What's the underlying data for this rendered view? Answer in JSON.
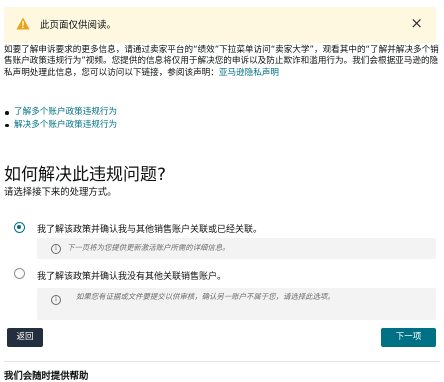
{
  "alert": {
    "message": "此页面仅供阅读。",
    "close_glyph": "×",
    "icon": "warning-triangle-icon",
    "color": "#fff8e1"
  },
  "intro": {
    "text_part1": "如要了解申诉要求的更多信息，请通过卖家平台的“绩效”下拉菜单访问“卖家大学”，观看其中的“了解并解决多个销售账户政策违规行为”视频。您提供的信息将仅用于解决您的申诉以及防止欺诈和滥用行为。我们会根据亚马逊的隐私声明处理此信息，您可以访问以下链接，参阅该声明：",
    "privacy_link": "亚马逊隐私声明"
  },
  "links": [
    {
      "label": "了解多个账户政策违规行为"
    },
    {
      "label": "解决多个账户政策违规行为"
    }
  ],
  "question": {
    "title": "如何解决此违规问题?",
    "subtitle": "请选择接下来的处理方式。"
  },
  "options": [
    {
      "label": "我了解该政策并确认我与其他销售账户关联或已经关联。",
      "selected": true,
      "info": "下一页将为您提供更新激活账户所需的详细信息。"
    },
    {
      "label": "我了解该政策并确认我没有其他关联销售账户。",
      "selected": false,
      "info": "如果您有证据或文件要提交以供审核，确认另一账户不属于您，请选择此选项。"
    }
  ],
  "buttons": {
    "back": "返回",
    "next": "下一项"
  },
  "footer": {
    "help": "我们会随时提供帮助"
  },
  "colors": {
    "accent": "#007185",
    "dark_button": "#232f3e",
    "warning_bg": "#fff8e1"
  }
}
